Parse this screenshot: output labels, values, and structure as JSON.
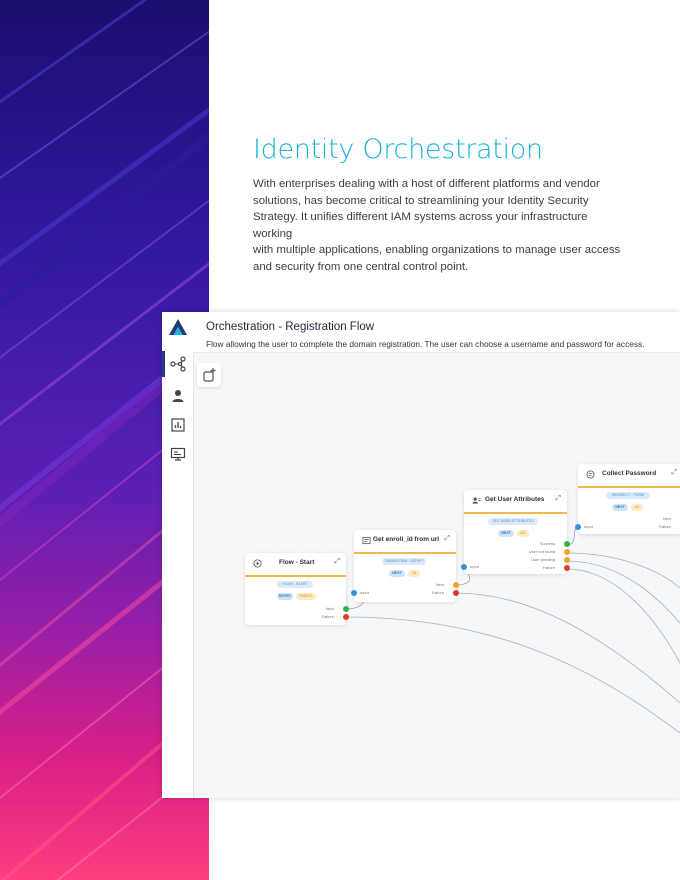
{
  "section": {
    "title": "Identity Orchestration",
    "intro_lines": [
      "With enterprises dealing with a host of different platforms and vendor",
      "solutions, has become critical to streamlining your Identity Security",
      "Strategy. It unifies different IAM systems across your infrastructure working",
      "with multiple applications, enabling organizations to manage user access",
      "and security from one central control point."
    ]
  },
  "app": {
    "sidebar_icons": [
      "app-logo-icon",
      "flow-network-icon",
      "user-icon",
      "analytics-icon",
      "monitor-icon"
    ],
    "title": "Orchestration - Registration Flow",
    "subtitle": "Flow allowing the user to complete the domain registration. The user can choose a username and password for access.",
    "nodes": {
      "start": {
        "title": "Flow - Start",
        "tag": "FLOW - START",
        "chips": [
          "ENTRY",
          "PUBLIC"
        ],
        "outputs": [
          "Next",
          "Failure"
        ]
      },
      "get_enroll": {
        "title": "Get enroll_id from url",
        "tag": "TRANSFORM - SCRIPT",
        "chips": [
          "NEXT",
          "JS"
        ],
        "inputs": [
          "Input"
        ],
        "outputs": [
          "Next",
          "Failure"
        ]
      },
      "get_user": {
        "title": "Get User Attributes",
        "tag": "GET USER ATTRIBUTES",
        "chips": [
          "NEXT",
          "AD"
        ],
        "inputs": [
          "Input"
        ],
        "outputs": [
          "Success",
          "User not found",
          "User pending",
          "Failure"
        ]
      },
      "collect_pw": {
        "title": "Collect Password",
        "tag": "REDIRECT - FORM",
        "chips": [
          "NEXT",
          "UI"
        ],
        "inputs": [
          "Input"
        ],
        "outputs": [
          "Next",
          "Failure"
        ]
      }
    }
  },
  "colors": {
    "heading": "#19b3d8",
    "accent_navy": "#233b78",
    "node_divider": "#f2b64a",
    "port_input": "#3b8fd8",
    "port_success": "#33b24a",
    "port_next": "#f0a526",
    "port_failure": "#e23a2e"
  }
}
